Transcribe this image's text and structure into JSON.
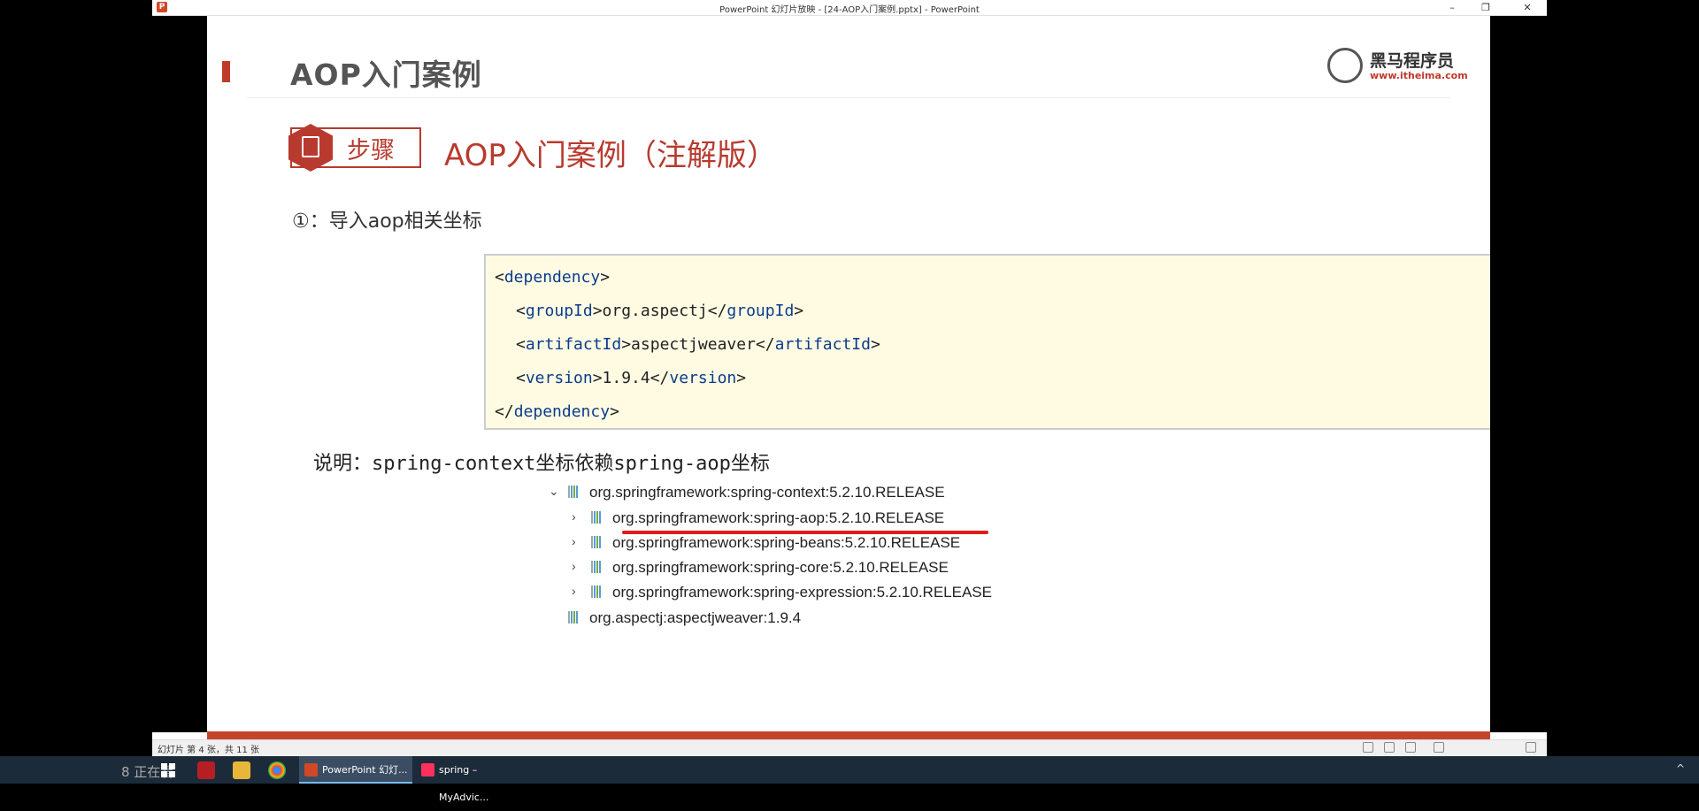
{
  "window": {
    "title": "PowerPoint 幻灯片放映 - [24-AOP入门案例.pptx] - PowerPoint",
    "app_icon": "P",
    "minimize_icon": "–",
    "restore_icon": "❐",
    "close_icon": "✕"
  },
  "slide": {
    "header_title": "AOP入门案例",
    "logo": {
      "name": "黑马程序员",
      "url": "www.itheima.com"
    },
    "step_label": "步骤",
    "step_title": "AOP入门案例（注解版）",
    "step_item": "①：导入aop相关坐标",
    "code": {
      "l1_open": "<",
      "l1_tag": "dependency",
      "l1_close": ">",
      "l2_a": "<",
      "l2_tag": "groupId",
      "l2_b": ">org.aspectj</",
      "l2_tag2": "groupId",
      "l2_c": ">",
      "l3_a": "<",
      "l3_tag": "artifactId",
      "l3_b": ">aspectjweaver</",
      "l3_tag2": "artifactId",
      "l3_c": ">",
      "l4_a": "<",
      "l4_tag": "version",
      "l4_b": ">1.9.4</",
      "l4_tag2": "version",
      "l4_c": ">",
      "l5_open": "</",
      "l5_tag": "dependency",
      "l5_close": ">"
    },
    "note": "说明：spring-context坐标依赖spring-aop坐标",
    "tree": [
      {
        "arrow": "⌄",
        "label": "org.springframework:spring-context:5.2.10.RELEASE"
      },
      {
        "arrow": "›",
        "label": "org.springframework:spring-aop:5.2.10.RELEASE",
        "highlight": true
      },
      {
        "arrow": "›",
        "label": "org.springframework:spring-beans:5.2.10.RELEASE"
      },
      {
        "arrow": "›",
        "label": "org.springframework:spring-core:5.2.10.RELEASE"
      },
      {
        "arrow": "›",
        "label": "org.springframework:spring-expression:5.2.10.RELEASE"
      },
      {
        "arrow": "",
        "label": "org.aspectj:aspectjweaver:1.9.4"
      }
    ]
  },
  "statusbar": {
    "slide_count": "幻灯片 第 4 张，共 11 张"
  },
  "taskbar": {
    "watch_text": "8 正在看",
    "items": [
      {
        "label": "PowerPoint 幻灯...",
        "icon": "powerpoint-icon"
      },
      {
        "label": "spring – MyAdvic...",
        "icon": "intellij-icon"
      }
    ],
    "tray_chevron": "^"
  },
  "colors": {
    "brand_red": "#b83a2e",
    "code_bg": "#fffbe3",
    "tag_blue": "#0b3c8c",
    "highlight_underline": "#e01b1b",
    "taskbar_bg": "#1c2b3a"
  }
}
